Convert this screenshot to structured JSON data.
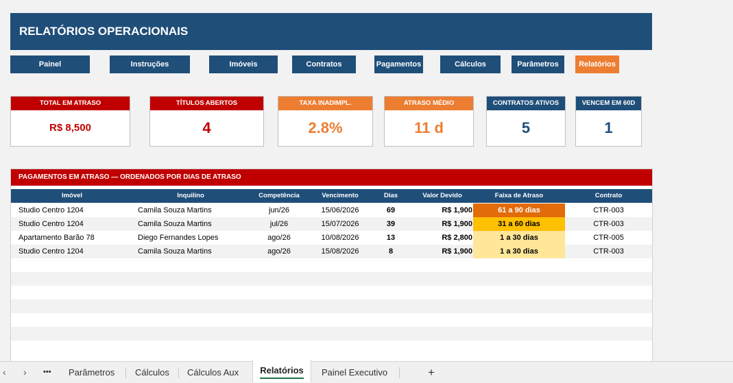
{
  "header": {
    "title": "RELATÓRIOS OPERACIONAIS"
  },
  "nav": [
    "Painel",
    "Instruções",
    "Imóveis",
    "Contratos",
    "Pagamentos",
    "Cálculos",
    "Parâmetros",
    "Relatórios"
  ],
  "nav_active": "Relatórios",
  "kpis": [
    {
      "label": "TOTAL EM ATRASO",
      "value": "R$ 8,500"
    },
    {
      "label": "TÍTULOS ABERTOS",
      "value": "4"
    },
    {
      "label": "TAXA INADIMPL.",
      "value": "2.8%"
    },
    {
      "label": "ATRASO MÉDIO",
      "value": "11 d"
    },
    {
      "label": "CONTRATOS ATIVOS",
      "value": "5"
    },
    {
      "label": "VENCEM EM 60D",
      "value": "1"
    }
  ],
  "colors": {
    "navy": "#1f4e79",
    "red": "#c00000",
    "orange": "#ed7d31",
    "band_61_90": "#e26b0a",
    "band_31_60": "#ffc000",
    "band_1_30": "#ffe699"
  },
  "table": {
    "title": "PAGAMENTOS EM ATRASO — ORDENADOS POR DIAS DE ATRASO",
    "headers": [
      "Imóvel",
      "Inquilino",
      "Competência",
      "Vencimento",
      "Dias",
      "Valor Devido",
      "Faixa de Atraso",
      "Contrato"
    ],
    "rows": [
      {
        "imovel": "Studio Centro 1204",
        "inquilino": "Camila Souza Martins",
        "competencia": "jun/26",
        "vencimento": "15/06/2026",
        "dias": "69",
        "valor": "R$ 1,900",
        "faixa": "61 a 90 dias",
        "contrato": "CTR-003"
      },
      {
        "imovel": "Studio Centro 1204",
        "inquilino": "Camila Souza Martins",
        "competencia": "jul/26",
        "vencimento": "15/07/2026",
        "dias": "39",
        "valor": "R$ 1,900",
        "faixa": "31 a 60 dias",
        "contrato": "CTR-003"
      },
      {
        "imovel": "Apartamento Barão 78",
        "inquilino": "Diego Fernandes Lopes",
        "competencia": "ago/26",
        "vencimento": "10/08/2026",
        "dias": "13",
        "valor": "R$ 2,800",
        "faixa": "1 a 30 dias",
        "contrato": "CTR-005"
      },
      {
        "imovel": "Studio Centro 1204",
        "inquilino": "Camila Souza Martins",
        "competencia": "ago/26",
        "vencimento": "15/08/2026",
        "dias": "8",
        "valor": "R$ 1,900",
        "faixa": "1 a 30 dias",
        "contrato": "CTR-003"
      }
    ]
  },
  "sheet_tabs": {
    "more": "•••",
    "items": [
      "Parâmetros",
      "Cálculos",
      "Cálculos Aux",
      "Relatórios",
      "Painel Executivo"
    ],
    "active": "Relatórios",
    "add": "+"
  }
}
